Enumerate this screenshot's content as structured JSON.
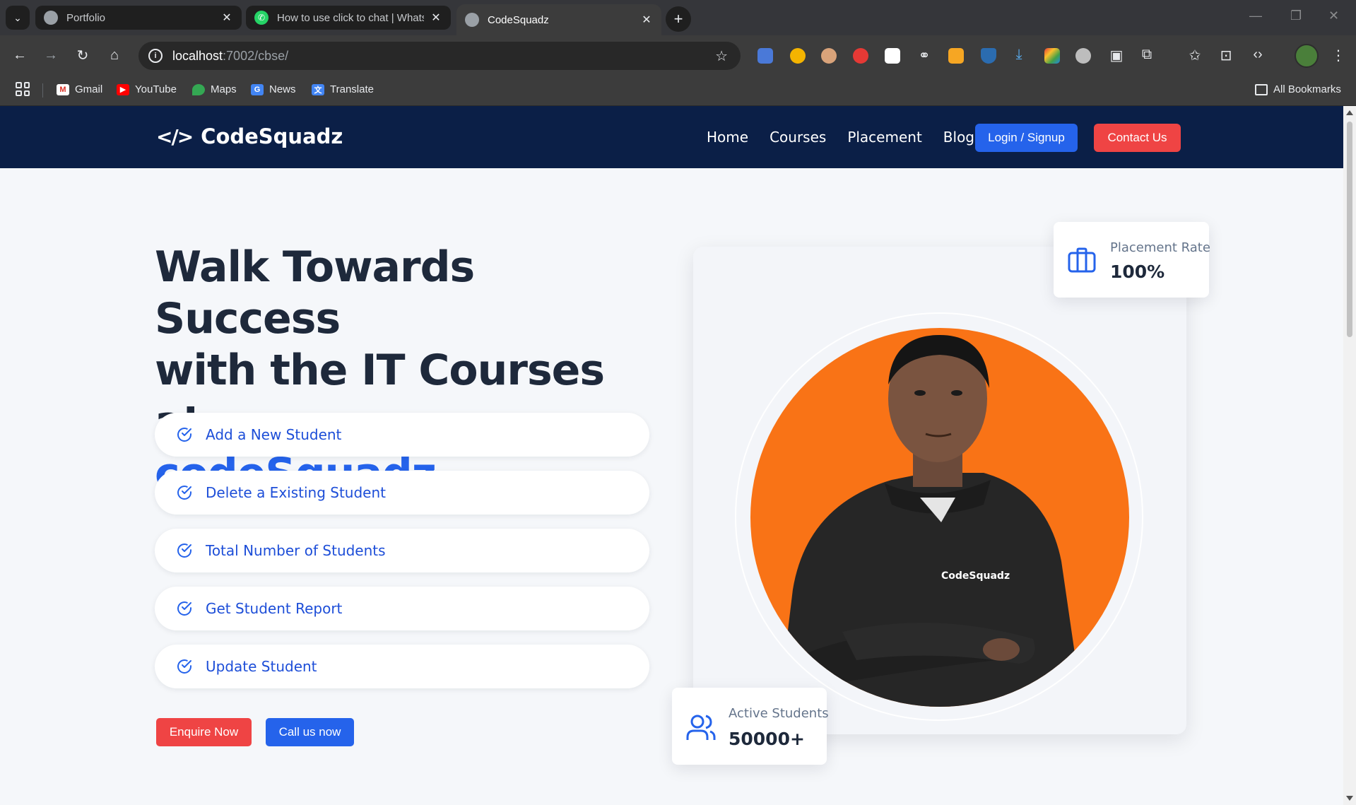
{
  "browser": {
    "tabs": [
      {
        "title": "Portfolio",
        "active": false
      },
      {
        "title": "How to use click to chat | WhatsApp",
        "active": false
      },
      {
        "title": "CodeSquadz",
        "active": true
      }
    ],
    "address": {
      "host": "localhost",
      "path": ":7002/cbse/"
    },
    "bookmarks": [
      {
        "label": "Gmail",
        "icon": "gmail-icon"
      },
      {
        "label": "YouTube",
        "icon": "youtube-icon"
      },
      {
        "label": "Maps",
        "icon": "maps-icon"
      },
      {
        "label": "News",
        "icon": "news-icon"
      },
      {
        "label": "Translate",
        "icon": "translate-icon"
      }
    ],
    "all_bookmarks": "All Bookmarks"
  },
  "site": {
    "logo_text": "CodeSquadz",
    "nav": [
      "Home",
      "Courses",
      "Placement",
      "Blog"
    ],
    "login_label": "Login / Signup",
    "contact_label": "Contact Us"
  },
  "hero": {
    "title_line1": "Walk Towards Success",
    "title_line2": "with the IT Courses at",
    "title_accent": "codeSquadz",
    "features": [
      "Add a New Student",
      "Delete a Existing Student",
      "Total Number of Students",
      "Get Student Report",
      "Update Student"
    ],
    "enquire_label": "Enquire Now",
    "call_label": "Call us now",
    "placement_label": "Placement Rate",
    "placement_value": "100%",
    "students_label": "Active Students",
    "students_value": "50000+",
    "shirt_text": "CodeSquadz"
  },
  "colors": {
    "header_bg": "#0b1f47",
    "primary": "#2563eb",
    "danger": "#ef4444",
    "accent_orange": "#f97316",
    "heading": "#1e293b"
  }
}
